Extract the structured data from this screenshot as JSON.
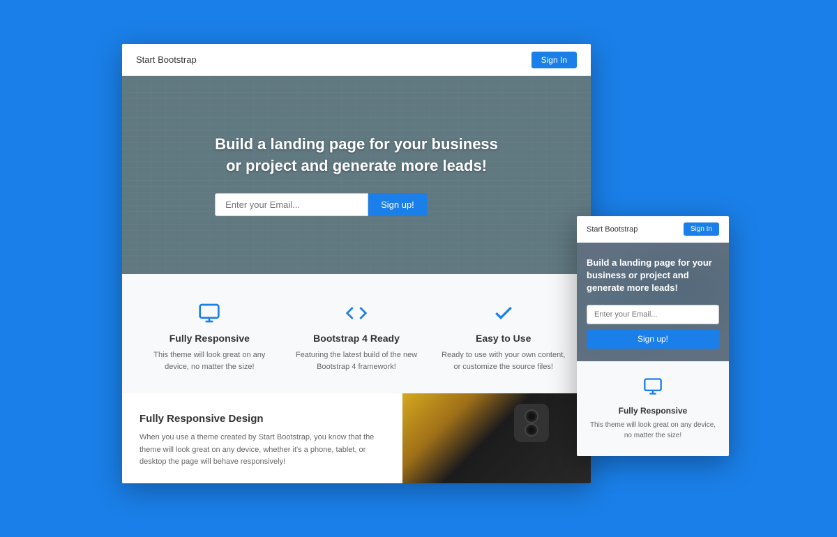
{
  "background_color": "#1a7fe8",
  "main_browser": {
    "navbar": {
      "brand": "Start Bootstrap",
      "signin_label": "Sign In"
    },
    "hero": {
      "headline_line1": "Build a landing page for your business",
      "headline_line2": "or project and generate more leads!",
      "email_placeholder": "Enter your Email...",
      "signup_label": "Sign up!"
    },
    "features": [
      {
        "id": "fully-responsive",
        "icon": "monitor-icon",
        "title": "Fully Responsive",
        "description": "This theme will look great on any device, no matter the size!"
      },
      {
        "id": "bootstrap-ready",
        "icon": "code-icon",
        "title": "Bootstrap 4 Ready",
        "description": "Featuring the latest build of the new Bootstrap 4 framework!"
      },
      {
        "id": "easy-to-use",
        "icon": "check-icon",
        "title": "Easy to Use",
        "description": "Ready to use with your own content, or customize the source files!"
      }
    ],
    "bottom": {
      "title": "Fully Responsive Design",
      "description": "When you use a theme created by Start Bootstrap, you know that the theme will look great on any device, whether it's a phone, tablet, or desktop the page will behave responsively!"
    }
  },
  "small_browser": {
    "navbar": {
      "brand": "Start Bootstrap",
      "signin_label": "Sign In"
    },
    "hero": {
      "headline": "Build a landing page for your business or project and generate more leads!",
      "email_placeholder": "Enter your Email...",
      "signup_label": "Sign up!"
    },
    "feature": {
      "icon": "monitor-icon",
      "title": "Fully Responsive",
      "description": "This theme will look great on any device, no matter the size!"
    }
  }
}
